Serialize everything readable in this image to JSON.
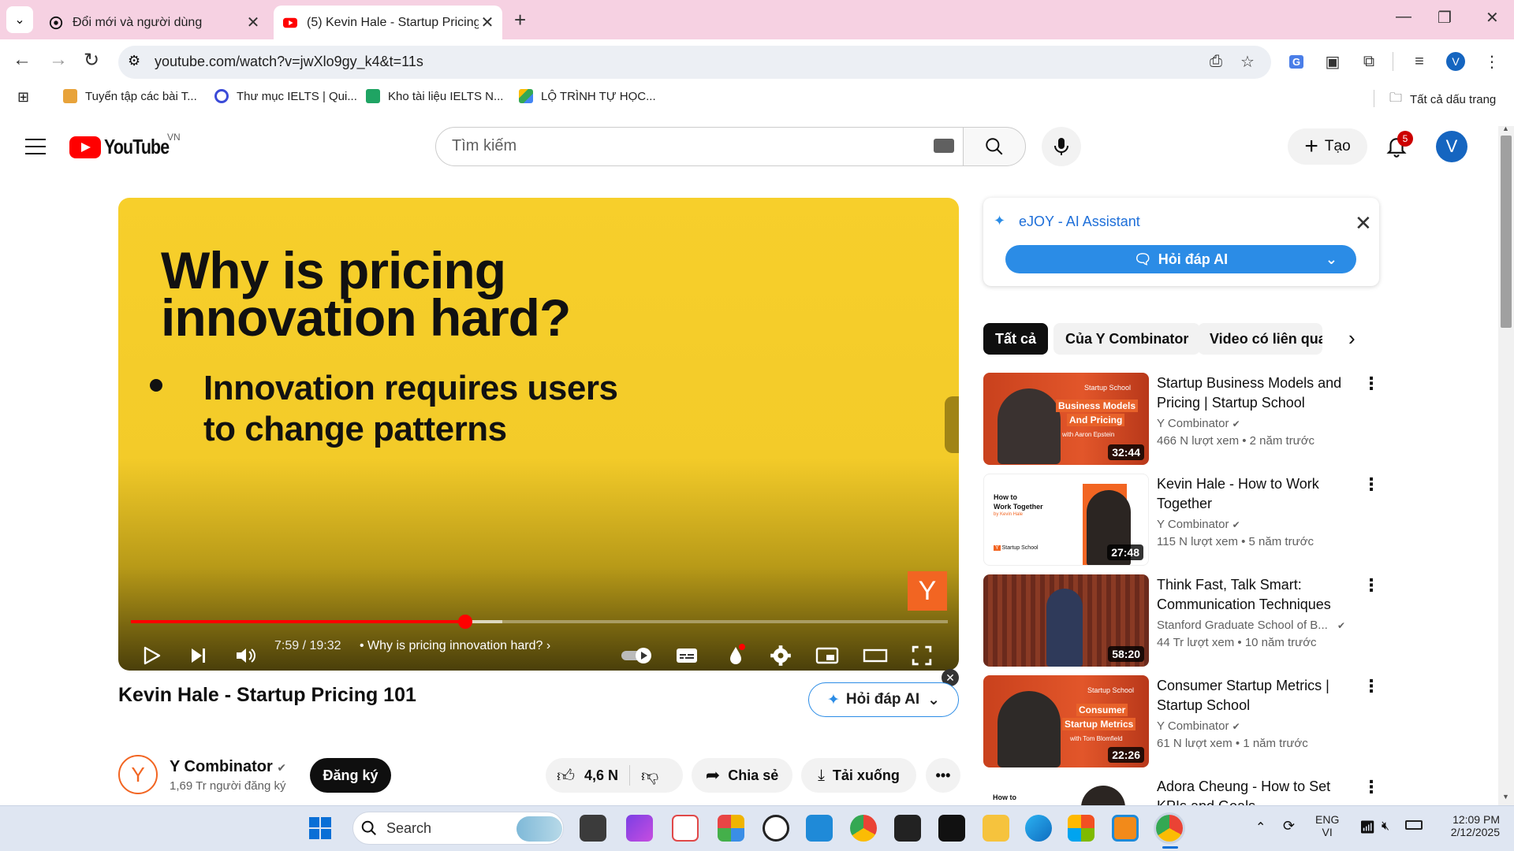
{
  "browser": {
    "tabs": [
      {
        "title": "Đổi mới và người dùng"
      },
      {
        "title": "(5) Kevin Hale - Startup Pricing"
      }
    ],
    "url": "youtube.com/watch?v=jwXlo9gy_k4&t=11s",
    "bookmarks": [
      {
        "label": "Tuyển tập các bài T..."
      },
      {
        "label": "Thư mục IELTS | Qui..."
      },
      {
        "label": "Kho tài liệu IELTS N..."
      },
      {
        "label": "LỘ TRÌNH TỰ HỌC..."
      }
    ],
    "all_bookmarks": "Tất cả dấu trang",
    "profile_initial": "V"
  },
  "youtube": {
    "logo_text": "YouTube",
    "region": "VN",
    "search_placeholder": "Tìm kiếm",
    "create_label": "Tạo",
    "notif_count": "5",
    "avatar_initial": "V"
  },
  "player": {
    "slide_title_line1": "Why is pricing",
    "slide_title_line2": "innovation hard?",
    "slide_bullet_line1": "Innovation requires users",
    "slide_bullet_line2": "to change patterns",
    "watermark": "Y",
    "time": "7:59 / 19:32",
    "chapter": "• Why is pricing innovation hard?",
    "progress": 0.409,
    "buffered": 0.455
  },
  "video": {
    "title": "Kevin Hale - Startup Pricing 101",
    "ai_button": "Hỏi đáp AI",
    "channel": {
      "name": "Y Combinator",
      "subs": "1,69 Tr người đăng ký",
      "avatar": "Y"
    },
    "subscribe": "Đăng ký",
    "likes": "4,6 N",
    "share": "Chia sẻ",
    "download": "Tải xuống"
  },
  "ejoy": {
    "title": "eJOY - AI Assistant",
    "button": "Hỏi đáp AI"
  },
  "chips": [
    "Tất cả",
    "Của Y Combinator",
    "Video có liên quan"
  ],
  "recommendations": [
    {
      "title": "Startup Business Models and Pricing | Startup School",
      "channel": "Y Combinator",
      "meta": "466 N lượt xem • 2 năm trước",
      "duration": "32:44",
      "thumb_tag": "Startup School",
      "thumb_text1": "Business Models",
      "thumb_text2": "And Pricing",
      "thumb_text3": "with Aaron Epstein"
    },
    {
      "title": "Kevin Hale - How to Work Together",
      "channel": "Y Combinator",
      "meta": "115 N lượt xem • 5 năm trước",
      "duration": "27:48",
      "thumb_text1": "How to",
      "thumb_text2": "Work Together",
      "thumb_text3": "by Kevin Hale",
      "thumb_tag": "Startup School"
    },
    {
      "title": "Think Fast, Talk Smart: Communication Techniques",
      "channel": "Stanford Graduate School of B...",
      "meta": "44 Tr lượt xem • 10 năm trước",
      "duration": "58:20"
    },
    {
      "title": "Consumer Startup Metrics | Startup School",
      "channel": "Y Combinator",
      "meta": "61 N lượt xem • 1 năm trước",
      "duration": "22:26",
      "thumb_tag": "Startup School",
      "thumb_text1": "Consumer",
      "thumb_text2": "Startup Metrics",
      "thumb_text3": "with Tom Blomfield"
    },
    {
      "title": "Adora Cheung - How to Set KPIs and Goals",
      "thumb_text1": "How to"
    }
  ],
  "taskbar": {
    "search": "Search",
    "lang_top": "ENG",
    "lang_bottom": "VI",
    "time": "12:09 PM",
    "date": "2/12/2025"
  },
  "colors": {
    "tabstrip": "#f6d1e2",
    "slide_yellow": "#f7cf2b",
    "yt_red": "#ff0000",
    "yc_orange": "#f26522",
    "ejoy_blue": "#2b8ce6"
  }
}
